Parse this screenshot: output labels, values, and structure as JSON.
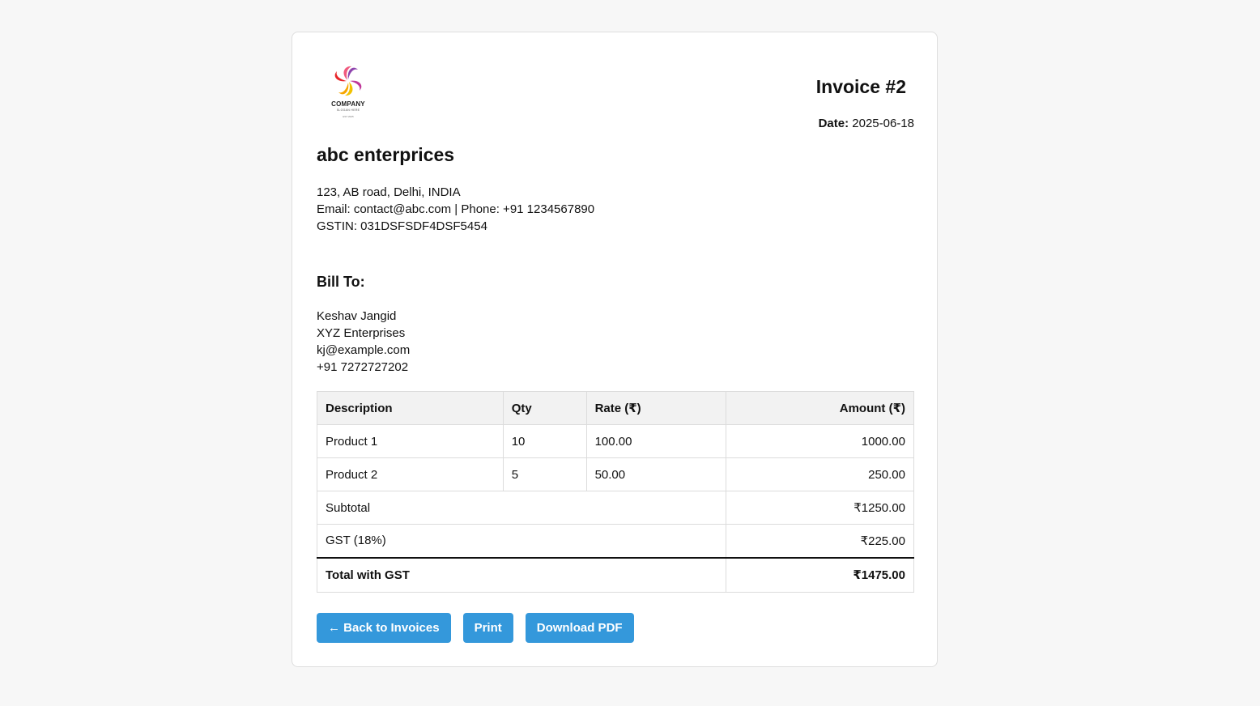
{
  "logo": {
    "name": "COMPANY",
    "slogan": "SLOGAN HERE",
    "tiny": "EST 2025",
    "colors": [
      "#e8262a",
      "#f7a600",
      "#8e44ad",
      "#f05a7e"
    ]
  },
  "invoice": {
    "title": "Invoice #2",
    "date_label": "Date:",
    "date_value": "2025-06-18"
  },
  "company": {
    "name": "abc enterprices",
    "address": "123, AB road, Delhi, INDIA",
    "contact": "Email: contact@abc.com | Phone: +91 1234567890",
    "gstin": "GSTIN: 031DSFSDF4DSF5454"
  },
  "bill_to": {
    "heading": "Bill To:",
    "name": "Keshav Jangid",
    "company": "XYZ Enterprises",
    "email": "kj@example.com",
    "phone": "+91 7272727202"
  },
  "table": {
    "headers": [
      "Description",
      "Qty",
      "Rate (₹)",
      "Amount (₹)"
    ],
    "rows": [
      [
        "Product 1",
        "10",
        "100.00",
        "1000.00"
      ],
      [
        "Product 2",
        "5",
        "50.00",
        "250.00"
      ]
    ],
    "subtotal_label": "Subtotal",
    "subtotal_value": "₹1250.00",
    "gst_label": "GST (18%)",
    "gst_value": "₹225.00",
    "total_label": "Total with GST",
    "total_value": "₹1475.00"
  },
  "actions": {
    "back": "← Back to Invoices",
    "print": "Print",
    "download": "Download PDF"
  },
  "colors": {
    "button": "#3498db",
    "header_bg": "#f2f2f2"
  }
}
